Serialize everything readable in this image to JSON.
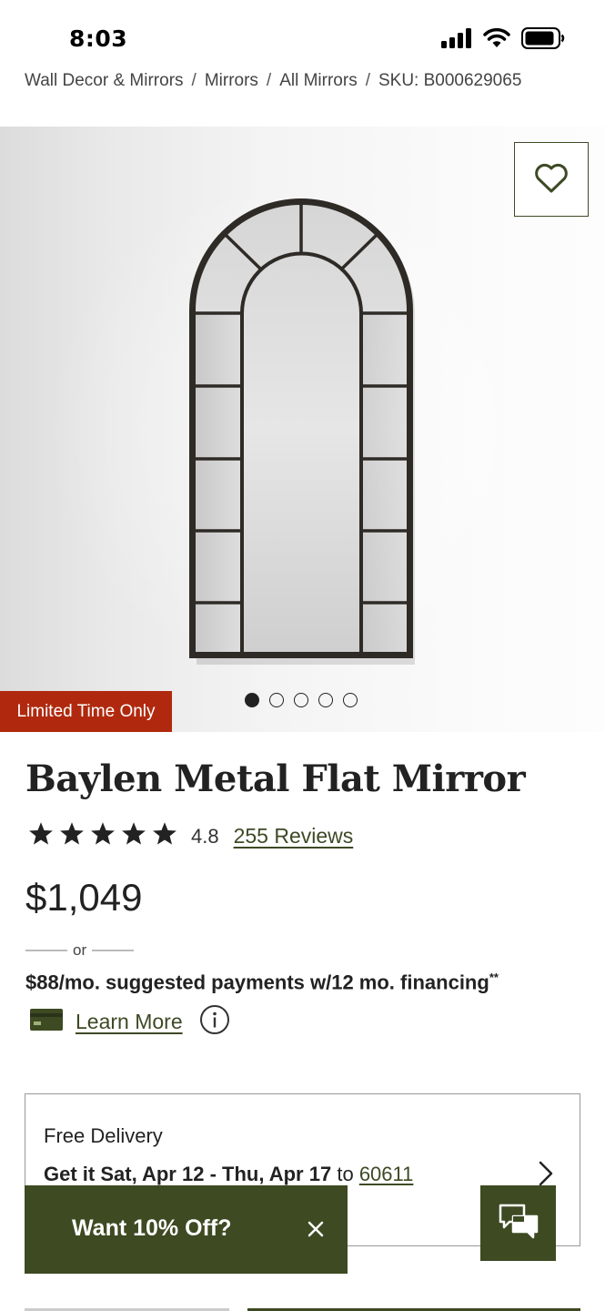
{
  "status_bar": {
    "time": "8:03",
    "icons": [
      "cellular-signal-icon",
      "wifi-icon",
      "battery-icon"
    ]
  },
  "breadcrumb": {
    "items": [
      "Wall Decor & Mirrors",
      "Mirrors",
      "All Mirrors",
      "SKU: B000629065"
    ],
    "separator": "/"
  },
  "gallery": {
    "image_subject": "arched-window-pane-metal-mirror",
    "badge": "Limited Time Only",
    "total_images": 5,
    "active_image": 1,
    "wishlist_icon": "heart-icon"
  },
  "product": {
    "title": "Baylen Metal Flat Mirror",
    "rating_value": "4.8",
    "rating_stars": 5,
    "reviews_link": "255 Reviews",
    "price": "$1,049",
    "or_text": "or",
    "financing_text": "$88/mo. suggested payments w/12 mo. financing",
    "financing_footnote": "**",
    "learn_more": "Learn More"
  },
  "delivery": {
    "title": "Free Delivery",
    "date_range": "Get it Sat, Apr 12 - Thu, Apr 17",
    "to_text": "to",
    "zip": "60611"
  },
  "promo": {
    "label": "Want 10% Off?",
    "close_icon": "close-icon"
  },
  "chat": {
    "icon": "chat-bubbles-icon"
  },
  "colors": {
    "brand_green": "#3d4a22",
    "badge_red": "#b0290f",
    "text_dark": "#222222"
  }
}
